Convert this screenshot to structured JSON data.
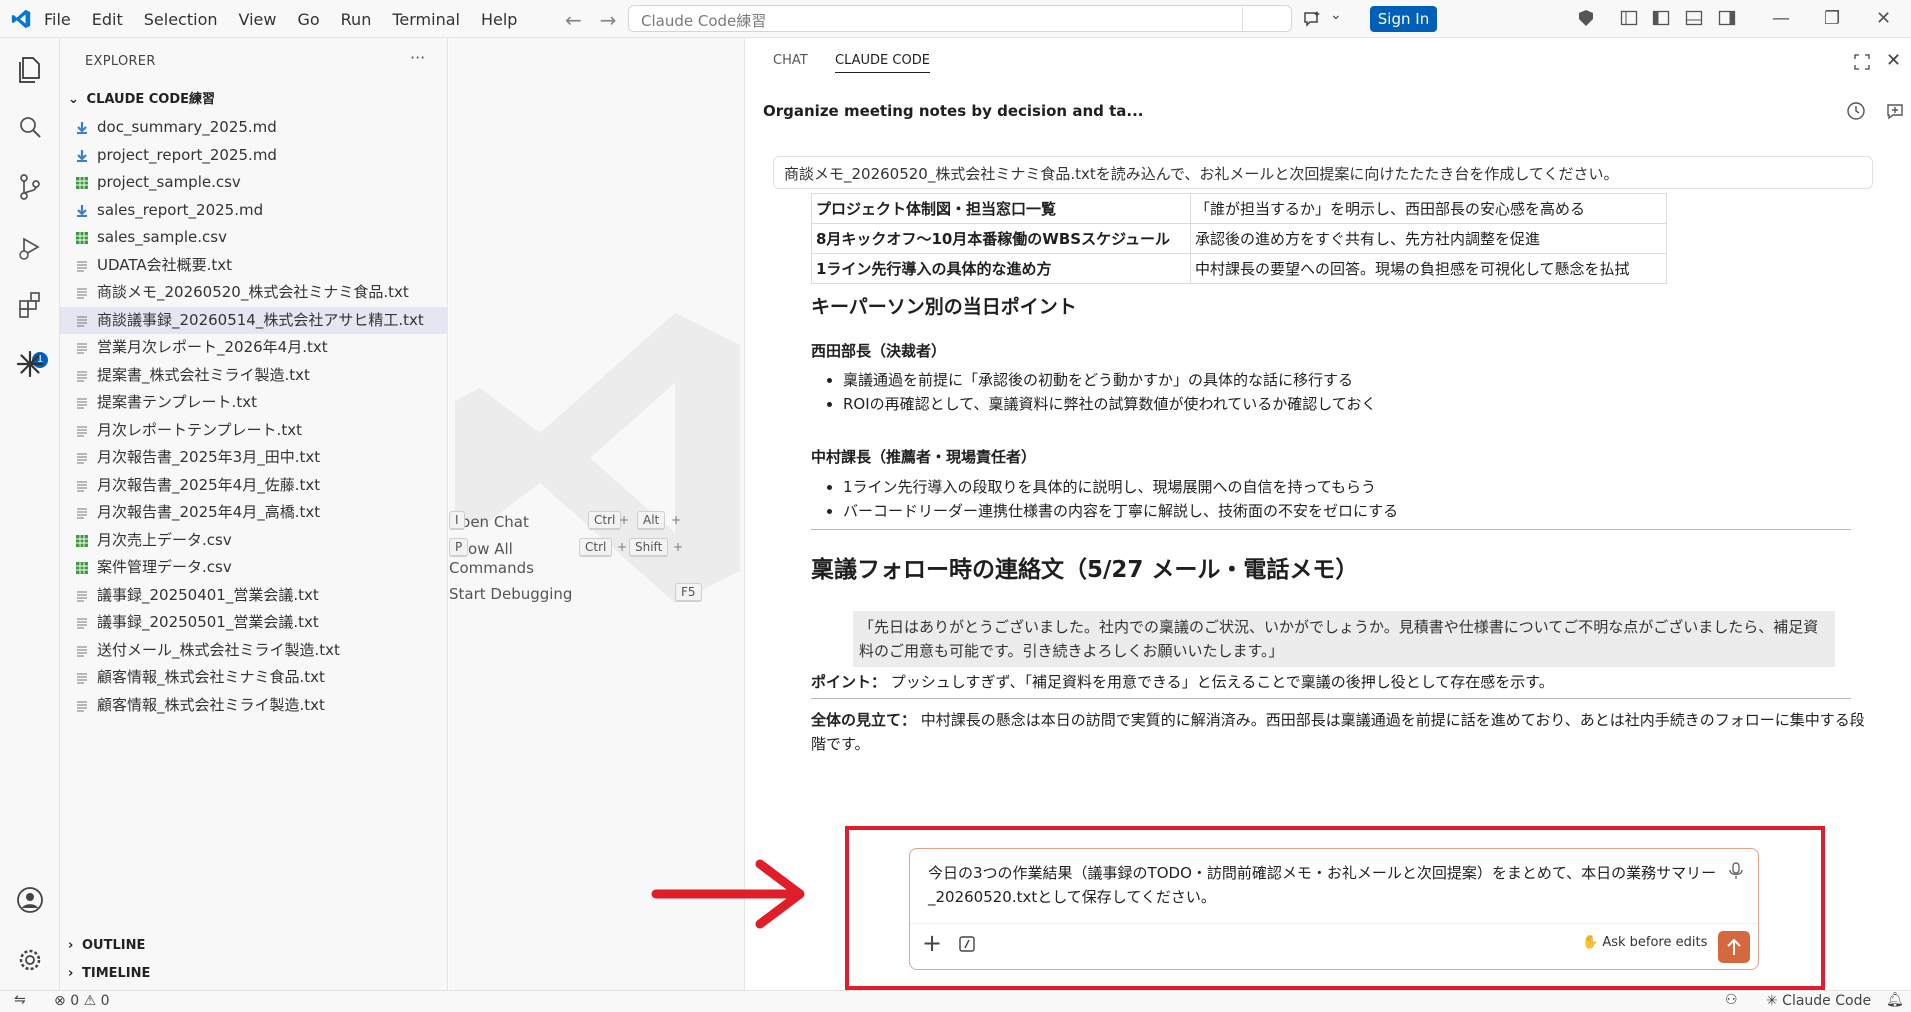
{
  "menu": [
    "File",
    "Edit",
    "Selection",
    "View",
    "Go",
    "Run",
    "Terminal",
    "Help"
  ],
  "search_placeholder": "Claude Code練習",
  "signin_label": "Sign In",
  "explorer": {
    "title": "EXPLORER",
    "more": "···",
    "folder": "CLAUDE CODE練習",
    "files": [
      {
        "name": "doc_summary_2025.md",
        "type": "md"
      },
      {
        "name": "project_report_2025.md",
        "type": "md"
      },
      {
        "name": "project_sample.csv",
        "type": "csv"
      },
      {
        "name": "sales_report_2025.md",
        "type": "md"
      },
      {
        "name": "sales_sample.csv",
        "type": "csv"
      },
      {
        "name": "UDATA会社概要.txt",
        "type": "txt"
      },
      {
        "name": "商談メモ_20260520_株式会社ミナミ食品.txt",
        "type": "txt"
      },
      {
        "name": "商談議事録_20260514_株式会社アサヒ精工.txt",
        "type": "txt",
        "selected": true
      },
      {
        "name": "営業月次レポート_2026年4月.txt",
        "type": "txt"
      },
      {
        "name": "提案書_株式会社ミライ製造.txt",
        "type": "txt"
      },
      {
        "name": "提案書テンプレート.txt",
        "type": "txt"
      },
      {
        "name": "月次レポートテンプレート.txt",
        "type": "txt"
      },
      {
        "name": "月次報告書_2025年3月_田中.txt",
        "type": "txt"
      },
      {
        "name": "月次報告書_2025年4月_佐藤.txt",
        "type": "txt"
      },
      {
        "name": "月次報告書_2025年4月_高橋.txt",
        "type": "txt"
      },
      {
        "name": "月次売上データ.csv",
        "type": "csv"
      },
      {
        "name": "案件管理データ.csv",
        "type": "csv"
      },
      {
        "name": "議事録_20250401_営業会議.txt",
        "type": "txt"
      },
      {
        "name": "議事録_20250501_営業会議.txt",
        "type": "txt"
      },
      {
        "name": "送付メール_株式会社ミライ製造.txt",
        "type": "txt"
      },
      {
        "name": "顧客情報_株式会社ミナミ食品.txt",
        "type": "txt"
      },
      {
        "name": "顧客情報_株式会社ミライ製造.txt",
        "type": "txt"
      }
    ],
    "outline": "OUTLINE",
    "timeline": "TIMELINE"
  },
  "editor_shortcuts": [
    {
      "label": "Open Chat",
      "keys": [
        "Ctrl",
        "Alt",
        "I"
      ]
    },
    {
      "label": "Show All Commands",
      "keys": [
        "Ctrl",
        "Shift",
        "P"
      ]
    },
    {
      "label": "Start Debugging",
      "keys": [
        "F5"
      ]
    }
  ],
  "panel": {
    "tab_chat": "CHAT",
    "tab_claude": "CLAUDE CODE",
    "session_title": "Organize meeting notes by decision and ta...",
    "prompt": "商談メモ_20260520_株式会社ミナミ食品.txtを読み込んで、お礼メールと次回提案に向けたたたき台を作成してください。",
    "table_rows": [
      [
        "プロジェクト体制図・担当窓口一覧",
        "「誰が担当するか」を明示し、西田部長の安心感を高める"
      ],
      [
        "8月キックオフ〜10月本番稼働のWBSスケジュール",
        "承認後の進め方をすぐ共有し、先方社内調整を促進"
      ],
      [
        "1ライン先行導入の具体的な進め方",
        "中村課長の要望への回答。現場の負担感を可視化して懸念を払拭"
      ]
    ],
    "keyperson_heading": "キーパーソン別の当日ポイント",
    "person1": "西田部長（決裁者）",
    "person1_points": [
      "稟議通過を前提に「承認後の初動をどう動かすか」の具体的な話に移行する",
      "ROIの再確認として、稟議資料に弊社の試算数値が使われているか確認しておく"
    ],
    "person2": "中村課長（推薦者・現場責任者）",
    "person2_points": [
      "1ライン先行導入の段取りを具体的に説明し、現場展開への自信を持ってもらう",
      "バーコードリーダー連携仕様書の内容を丁寧に解説し、技術面の不安をゼロにする"
    ],
    "followup_heading": "稟議フォロー時の連絡文（5/27 メール・電話メモ）",
    "followup_quote": "「先日はありがとうございました。社内での稟議のご状況、いかがでしょうか。見積書や仕様書についてご不明な点がございましたら、補足資料のご用意も可能です。引き続きよろしくお願いいたします。」",
    "point_label": "ポイント：",
    "point_text": "プッシュしすぎず、「補足資料を用意できる」と伝えることで稟議の後押し役として存在感を示す。",
    "overall_label": "全体の見立て：",
    "overall_text": "中村課長の懸念は本日の訪問で実質的に解消済み。西田部長は稟議通過を前提に話を進めており、あとは社内手続きのフォローに集中する段階です。",
    "input_text": "今日の3つの作業結果（議事録のTODO・訪問前確認メモ・お礼メールと次回提案）をまとめて、本日の業務サマリー_20260520.txtとして保存してください。",
    "ask_before_edits": "Ask before edits"
  },
  "status": {
    "errors": "0",
    "warnings": "0",
    "claude_code": "✳ Claude Code"
  },
  "colors": {
    "accent": "#005fb8",
    "send_button": "#d4693f",
    "highlight_box": "#e01e2a"
  }
}
